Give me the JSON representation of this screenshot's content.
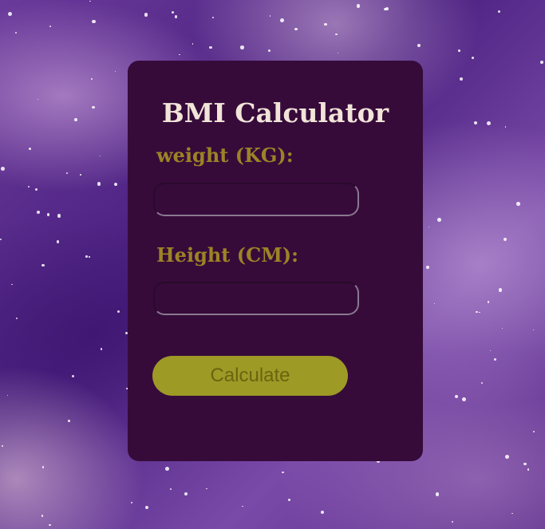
{
  "title": "BMI Calculator",
  "weight_label": "weight (KG):",
  "height_label": "Height (CM):",
  "weight_value": "",
  "height_value": "",
  "button_label": "Calculate"
}
